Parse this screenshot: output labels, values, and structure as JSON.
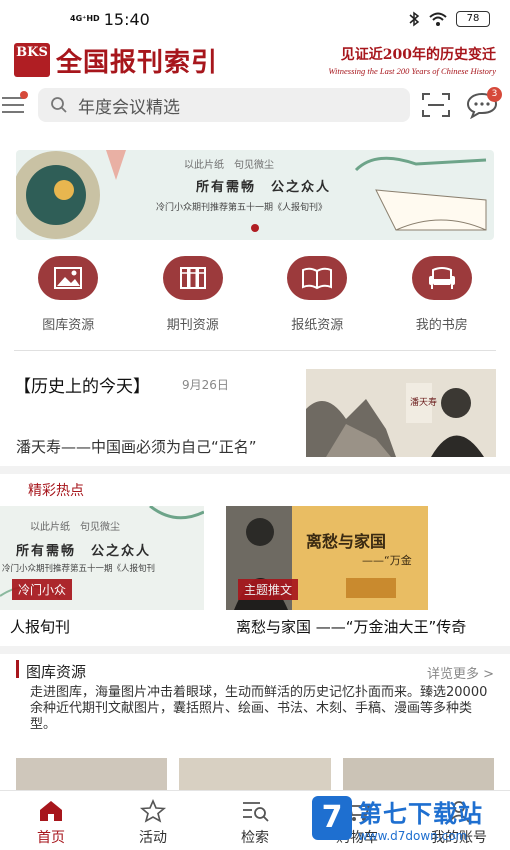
{
  "status_bar": {
    "network": "4G⁺HD",
    "time": "15:40",
    "battery": "78"
  },
  "brand": {
    "logo_text": "BKS",
    "name": "全国报刊索引",
    "slogan_zh": "见证近200年的历史变迁",
    "slogan_en": "Witnessing the Last 200 Years of Chinese History"
  },
  "search": {
    "placeholder": "年度会议精选",
    "message_badge": "3"
  },
  "banner": {
    "line1": "以此片纸　句见微尘",
    "line2": "所有需畅　公之众人",
    "line3": "冷门小众期刊推荐第五十一期《人报旬刊》",
    "active_slide": 1,
    "slide_count": 1
  },
  "quick_nav": [
    {
      "label": "图库资源",
      "icon": "image-icon"
    },
    {
      "label": "期刊资源",
      "icon": "books-icon"
    },
    {
      "label": "报纸资源",
      "icon": "open-book-icon"
    },
    {
      "label": "我的书房",
      "icon": "armchair-icon"
    }
  ],
  "today": {
    "title": "【历史上的今天】",
    "date": "9月26日",
    "subtitle": "潘天寿——中国画必须为自己“正名”"
  },
  "hot": {
    "title": "精彩热点",
    "cards": [
      {
        "tag": "冷门小众",
        "caption": "人报旬刊",
        "img_line1": "以此片纸　句见微尘",
        "img_line2": "所有需畅　公之众人",
        "img_line3": "冷门小众期刊推荐第五十一期《人报旬刊"
      },
      {
        "tag": "主题推文",
        "caption": "离愁与家国 ——“万金油大王”传奇",
        "img_line1": "离愁与家国",
        "img_line2": "——“万金"
      }
    ]
  },
  "gallery": {
    "title": "图库资源",
    "more": "详览更多 >",
    "description": "走进图库，海量图片冲击着眼球，生动而鲜活的历史记忆扑面而来。臻选20000余种近代期刊文献图片，囊括照片、绘画、书法、木刻、手稿、漫画等多种类型。"
  },
  "tabs": [
    {
      "label": "首页",
      "icon": "home-icon",
      "active": true
    },
    {
      "label": "活动",
      "icon": "star-icon",
      "active": false
    },
    {
      "label": "检索",
      "icon": "search-list-icon",
      "active": false
    },
    {
      "label": "购物车",
      "icon": "cart-icon",
      "active": false
    },
    {
      "label": "我的账号",
      "icon": "user-icon",
      "active": false
    }
  ],
  "watermark": {
    "name": "第七下载站",
    "url": "www.d7down.com",
    "mark": "7"
  },
  "colors": {
    "brand_red": "#a7161c",
    "icon_red": "#9c3a3c"
  }
}
